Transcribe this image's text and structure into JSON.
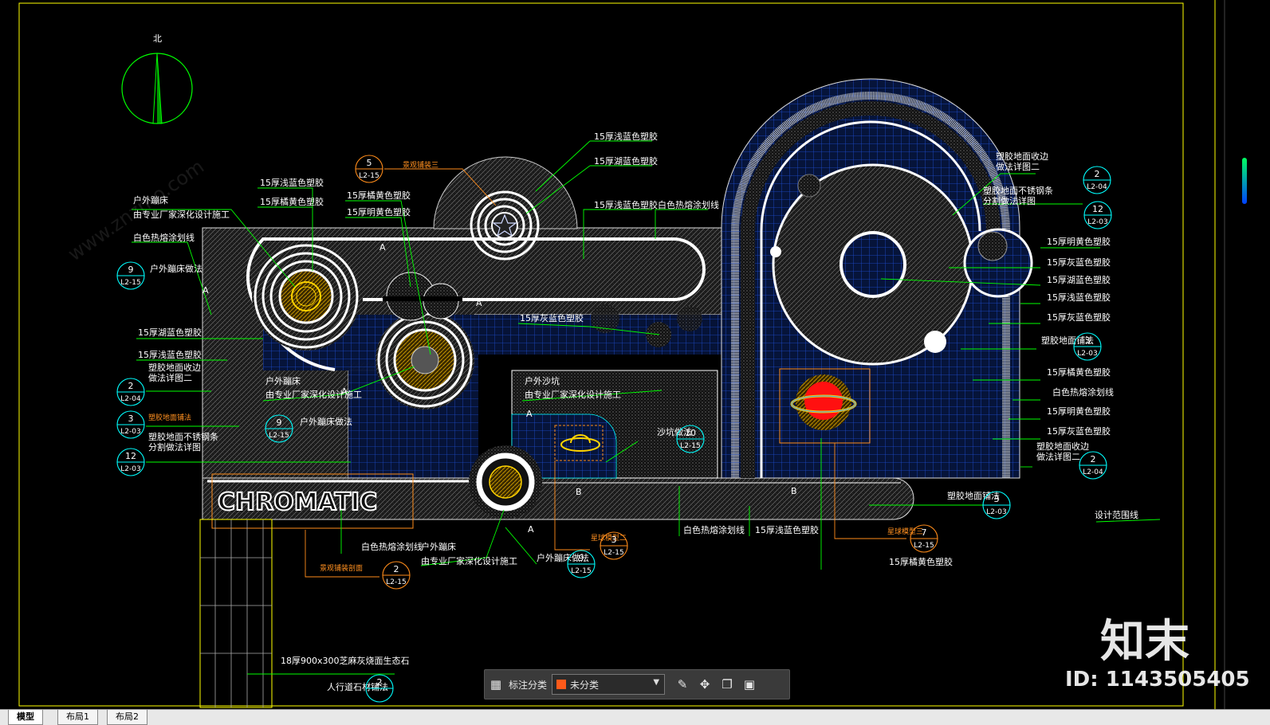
{
  "colors": {
    "background": "#000000",
    "border_yellow": "#ffff00",
    "leader_green": "#00ff00",
    "grid_blue": "#0a2a8a",
    "tag_orange": "#ff8c1a",
    "planet_red": "#ff1010"
  },
  "compass": {
    "label": "北"
  },
  "logo": {
    "text": "CHROMATIC"
  },
  "section_marks": [
    "A",
    "A",
    "A",
    "A",
    "A",
    "A",
    "B",
    "B"
  ],
  "labels": {
    "l1": "15厚浅蓝色塑胶",
    "l2": "15厚湖蓝色塑胶",
    "l3": "15厚浅蓝色塑胶",
    "l4": "15厚橘黄色塑胶",
    "l5": "15厚橘黄色塑胶",
    "l6": "15厚明黄色塑胶",
    "l7": "户外蹦床",
    "l8": "由专业厂家深化设计施工",
    "l9": "白色热熔涂划线",
    "l10": "15厚浅蓝色塑胶",
    "l11": "白色热熔涂划线",
    "l12": "15厚湖蓝色塑胶",
    "l13": "15厚浅蓝色塑胶",
    "l14": "塑胶地面收边",
    "l15": "做法详图二",
    "l16": "塑胶地面铺法",
    "l17": "塑胶地面不锈钢条",
    "l18": "分割做法详图",
    "l19": "户外蹦床",
    "l20": "由专业厂家深化设计施工",
    "l21": "户外沙坑",
    "l22": "由专业厂家深化设计施工",
    "l23": "15厚灰蓝色塑胶",
    "l24": "沙坑做法",
    "l25": "户外蹦床做法",
    "l26": "户外蹦床做法",
    "l27": "白色热熔涂划线",
    "l28": "户外蹦床",
    "l29": "由专业厂家深化设计施工",
    "l30": "白色热熔涂划线",
    "l31": "15厚浅蓝色塑胶",
    "l32": "15厚橘黄色塑胶",
    "l33": "塑胶地面收边",
    "l34": "做法详图二",
    "l35": "塑胶地面不锈钢条",
    "l36": "分割做法详图",
    "l37": "15厚明黄色塑胶",
    "l38": "15厚灰蓝色塑胶",
    "l39": "15厚湖蓝色塑胶",
    "l40": "15厚浅蓝色塑胶",
    "l41": "15厚灰蓝色塑胶",
    "l42": "塑胶地面铺法",
    "l43": "15厚橘黄色塑胶",
    "l44": "白色热熔涂划线",
    "l45": "15厚明黄色塑胶",
    "l46": "15厚灰蓝色塑胶",
    "l47": "塑胶地面收边",
    "l48": "做法详图二",
    "l49": "塑胶地面铺法",
    "l50": "设计范围线",
    "l51": "18厚900x300芝麻灰烧面生态石",
    "l52": "人行道石材铺法",
    "l53": "景观铺装剖面",
    "l54": "星球模型三",
    "l55": "星球模型二",
    "l56": "景观铺装三",
    "l57": "户外蹦床做法"
  },
  "tags": [
    {
      "num": "5",
      "ref": "L2-15"
    },
    {
      "num": "9",
      "ref": "L2-15"
    },
    {
      "num": "2",
      "ref": "L2-04"
    },
    {
      "num": "3",
      "ref": "L2-03"
    },
    {
      "num": "12",
      "ref": "L2-03"
    },
    {
      "num": "9",
      "ref": "L2-15"
    },
    {
      "num": "10",
      "ref": "L2-15"
    },
    {
      "num": "2",
      "ref": "L2-04"
    },
    {
      "num": "12",
      "ref": "L2-03"
    },
    {
      "num": "3",
      "ref": "L2-03"
    },
    {
      "num": "2",
      "ref": "L2-04"
    },
    {
      "num": "3",
      "ref": "L2-03"
    },
    {
      "num": "7",
      "ref": "L2-15"
    },
    {
      "num": "3",
      "ref": "L2-15"
    },
    {
      "num": "9",
      "ref": "L2-15"
    },
    {
      "num": "2",
      "ref": "L2-15"
    },
    {
      "num": "2",
      "ref": ""
    }
  ],
  "toolbar": {
    "category_label": "标注分类",
    "category_value": "未分类",
    "swatch_color": "#ff5a1a"
  },
  "tabs": {
    "model": "模型",
    "layout1": "布局1",
    "layout2": "布局2"
  },
  "watermark": {
    "brand": "知末",
    "id": "ID: 1143505405",
    "site": "www.znzmo.com"
  }
}
